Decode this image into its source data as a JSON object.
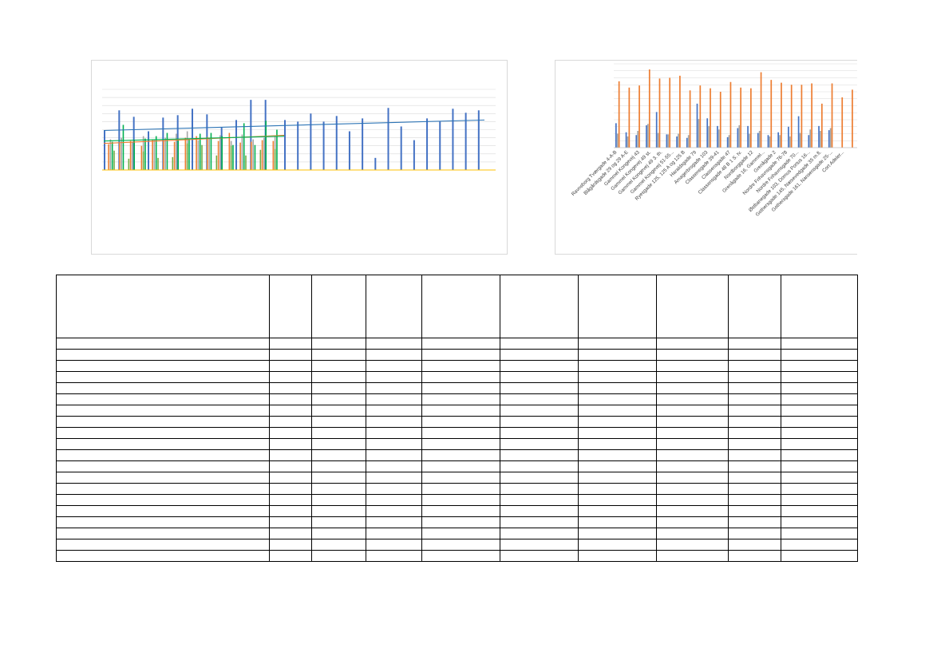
{
  "colors": {
    "blue": "#4472c4",
    "orange": "#ed7d31",
    "gray": "#a5a5a5",
    "green": "#70ad47",
    "bright_green": "#00b050",
    "yellow": "#ffc000",
    "trend_blue": "#2e75b6",
    "trend_orange": "#ed7d31",
    "grid": "#d9d9d9",
    "axis": "#ffc000"
  },
  "chart_data": [
    {
      "type": "bar",
      "title": "",
      "xlabel": "",
      "ylabel": "",
      "grid": true,
      "ylim": [
        0,
        10
      ],
      "legend": "none",
      "trendlines": [
        {
          "series": "Series 1",
          "from": 4.9,
          "to": 6.2
        },
        {
          "series": "Series 2",
          "from": 3.3,
          "to": 4.3
        },
        {
          "series": "Series 4",
          "from": 3.6,
          "to": 4.2
        }
      ],
      "series": [
        {
          "values": [
            4.9,
            7.4,
            6.6,
            4.8,
            6.5,
            6.8,
            7.6,
            6.9,
            5.3,
            6.2,
            8.7,
            8.7,
            6.2,
            6.0,
            7.0,
            6.0,
            6.7,
            4.8,
            6.4,
            1.5,
            7.7,
            5.4,
            3.7,
            6.4,
            6.0,
            7.6,
            7.1,
            7.4
          ]
        },
        {
          "values": [
            3.2,
            3.3,
            3.6,
            3.0,
            3.8,
            3.6,
            3.5,
            4.0,
            4.2,
            4.1,
            3.6,
            4.6,
            3.4,
            3.5,
            3.7,
            3.6
          ]
        },
        {
          "values": [
            3.8,
            4.0,
            3.5,
            4.2,
            3.8,
            4.0,
            4.5,
            4.8,
            3.7,
            3.9,
            4.3,
            3.6,
            4.4,
            3.8,
            4.0,
            4.2
          ]
        },
        {
          "values": [
            3.5,
            5.6,
            3.7,
            3.9,
            4.2,
            4.6,
            3.7,
            3.9,
            4.5,
            4.6,
            4.2,
            3.1,
            5.8,
            3.1,
            6.1,
            5.0
          ]
        },
        {
          "values": [
            2.4,
            1.4,
            2.3,
            1.5,
            1.6,
            3.3,
            3.1,
            1.8,
            3.0,
            1.8,
            2.5,
            2.6
          ]
        }
      ]
    },
    {
      "type": "bar",
      "title": "",
      "xlabel": "",
      "ylabel": "",
      "grid": true,
      "ylim": [
        0,
        10
      ],
      "legend": "none",
      "categories": [
        "Ravnsborg Tværgade 4-A-B",
        "Blågårdsgade 29 og 29 A-E",
        "Gammel Kongevej 43",
        "Gammel Kongevej 49 st.",
        "Gammel Kongevej 49 3. th.",
        "Gammel Kongevej 51-55...",
        "Ryesgade 125, 125 A og 125 B",
        "Haraldsgade 79",
        "Amagerbrogade 103",
        "Classensgade 39-41",
        "Classensgade 47",
        "Classensgade 48 B 1 S. tv.",
        "Nordborggade 12",
        "Grenågade 16, Gammel...",
        "Grenågade 2",
        "Nordre Frihavnsgade 76-78",
        "Nordre Frihavnsgade 70...",
        "Østbanegade 103, Domus Portus 16...",
        "Gothersgade 145, Næsevedgade 35 m.fl.",
        "Gothersgade 161, Nansensgade 25-...",
        "Cort Adeler..."
      ],
      "series": [
        {
          "color_key": "blue",
          "values": [
            3.5,
            2.2,
            1.8,
            3.2,
            5.1,
            1.9,
            1.6,
            1.4,
            6.3,
            4.2,
            3.1,
            1.5,
            2.8,
            3.1,
            2.1,
            1.8,
            2.2,
            3.0,
            4.5,
            1.8,
            3.1,
            2.5
          ]
        },
        {
          "color_key": "gray",
          "values": [
            2.0,
            1.6,
            2.4,
            3.4,
            2.1,
            1.9,
            2.0,
            1.8,
            4.1,
            3.1,
            2.6,
            1.8,
            3.2,
            2.0,
            2.4,
            1.6,
            1.8,
            1.6,
            2.1,
            2.6,
            2.4,
            2.8
          ]
        },
        {
          "color_key": "orange",
          "values": [
            9.5,
            8.6,
            8.9,
            11.2,
            9.9,
            10.0,
            10.3,
            8.2,
            8.9,
            8.5,
            8.0,
            9.4,
            8.6,
            8.5,
            10.8,
            9.7,
            9.3,
            9.0,
            9.0,
            9.2,
            6.3,
            9.2,
            7.2,
            8.3
          ]
        }
      ]
    }
  ],
  "table": {
    "column_widths": [
      267,
      53,
      68,
      70,
      98,
      98,
      98,
      90,
      66,
      96
    ],
    "row_count": 20
  }
}
